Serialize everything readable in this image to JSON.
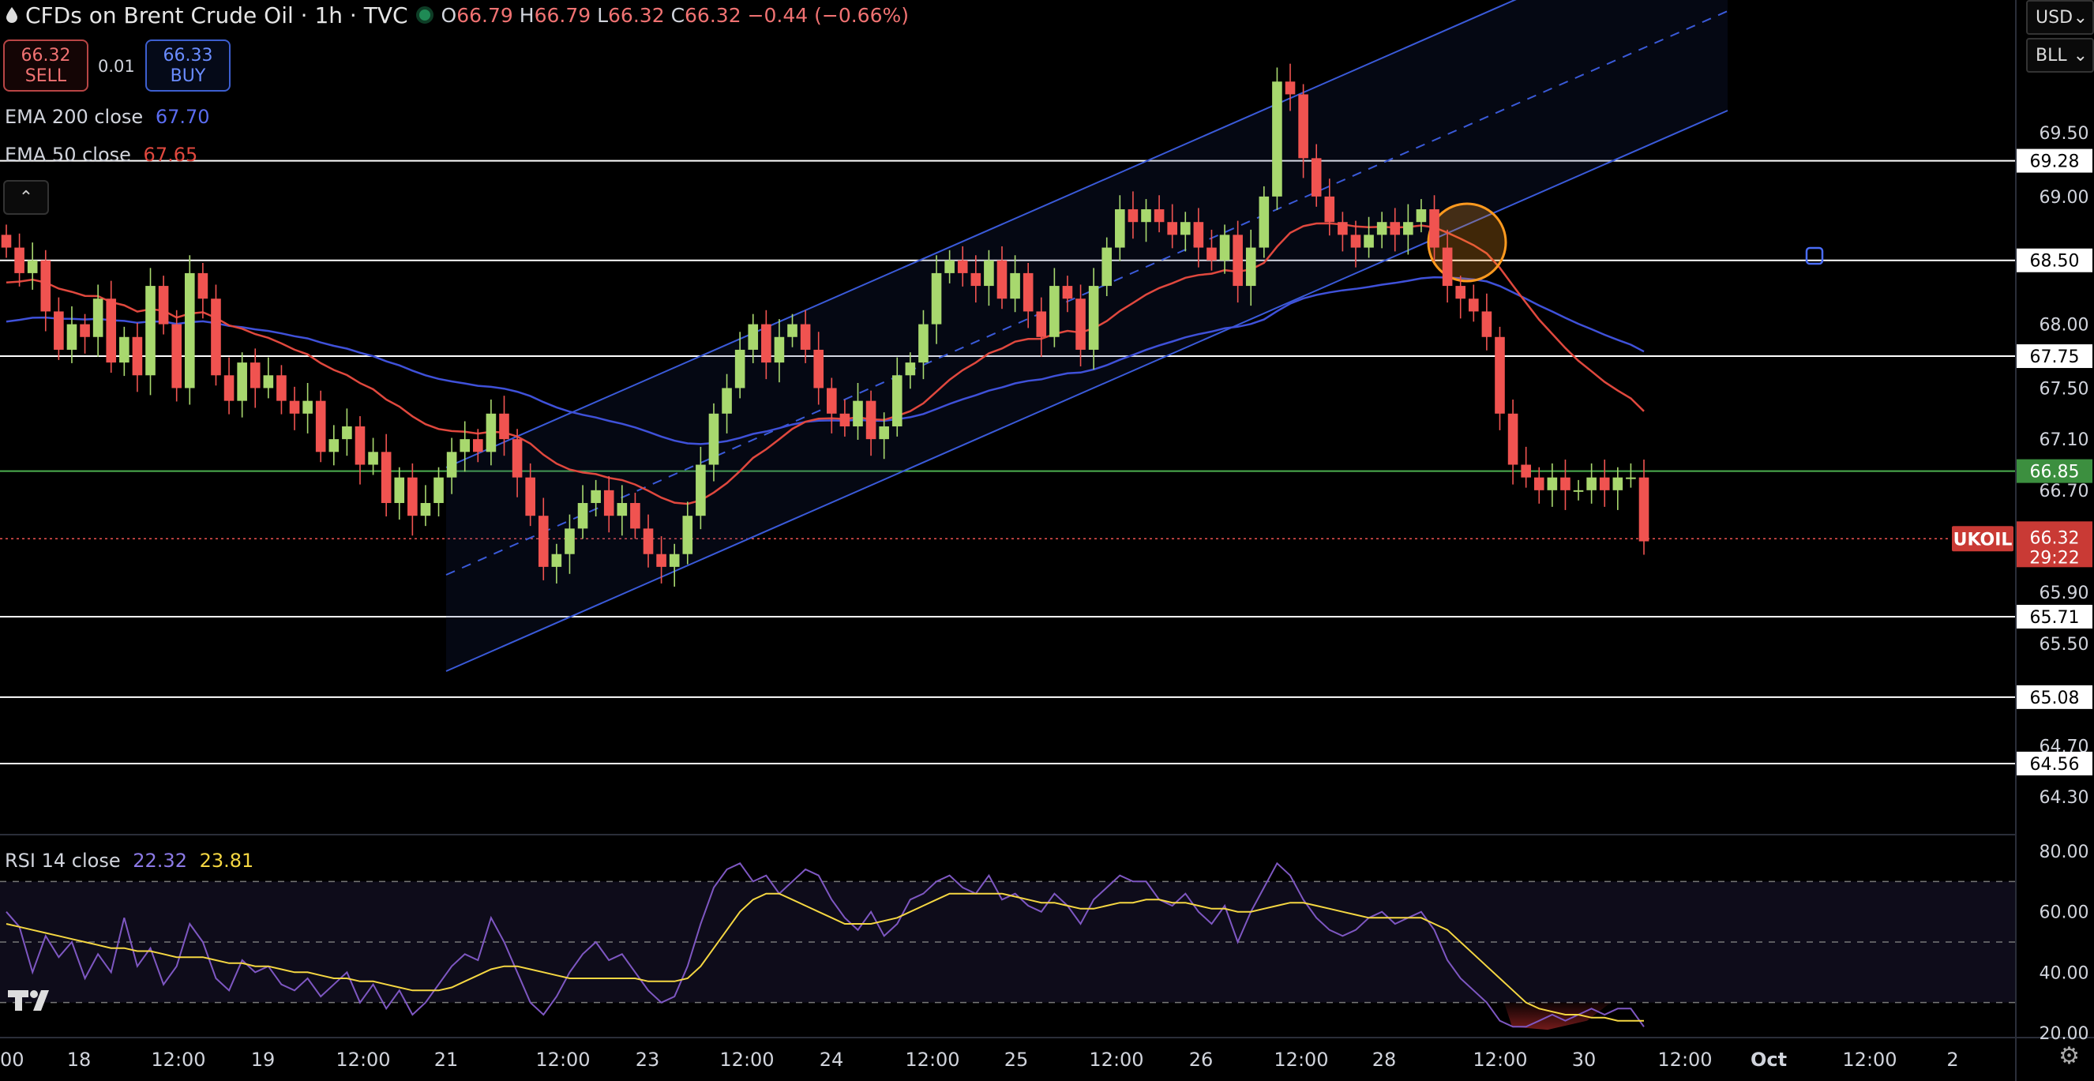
{
  "header": {
    "title": "CFDs on Brent Crude Oil · 1h · TVC",
    "ohlc": {
      "o_lbl": "O",
      "o": "66.79",
      "h_lbl": "H",
      "h": "66.79",
      "l_lbl": "L",
      "l": "66.32",
      "c_lbl": "C",
      "c": "66.32",
      "chg": "−0.44 (−0.66%)"
    }
  },
  "trade": {
    "sell_price": "66.32",
    "sell_label": "SELL",
    "spread": "0.01",
    "buy_price": "66.33",
    "buy_label": "BUY"
  },
  "indicators": {
    "ema200_label": "EMA 200 close",
    "ema200_value": "67.70",
    "ema50_label": "EMA 50 close",
    "ema50_value": "67.65",
    "rsi_label": "RSI 14 close",
    "rsi_value": "22.32",
    "rsi_ma_value": "23.81"
  },
  "top_right": {
    "currency": "USD",
    "unit": "BLL"
  },
  "colors": {
    "up": "#26a69a",
    "green_candle": "#a8d86e",
    "down": "#f05350",
    "ema200": "#3f51d9",
    "ema50": "#e0483e",
    "rsi": "#7e57c2",
    "rsi_ma": "#f5d742",
    "channel": "#3a5ad9",
    "level": "#ffffff",
    "support_green": "#4caf50"
  },
  "chart_data": [
    {
      "type": "candlestick",
      "symbol": "UKOIL",
      "interval": "1h",
      "last_price": "66.32",
      "countdown": "29:22",
      "y_ticks": [
        "69.50",
        "69.00",
        "68.50",
        "68.00",
        "67.50",
        "67.10",
        "66.70",
        "66.30",
        "65.90",
        "65.50",
        "64.70",
        "64.30"
      ],
      "ylim": [
        64.0,
        70.2
      ],
      "x_ticks": [
        "00",
        "18",
        "12:00",
        "19",
        "12:00",
        "21",
        "12:00",
        "23",
        "12:00",
        "24",
        "12:00",
        "25",
        "12:00",
        "26",
        "12:00",
        "28",
        "12:00",
        "30",
        "12:00",
        "Oct",
        "12:00",
        "2"
      ],
      "levels": [
        {
          "value": "69.28",
          "color": "#ffffff"
        },
        {
          "value": "68.50",
          "color": "#ffffff"
        },
        {
          "value": "67.75",
          "color": "#ffffff"
        },
        {
          "value": "66.85",
          "color": "#4caf50"
        },
        {
          "value": "65.71",
          "color": "#ffffff"
        },
        {
          "value": "65.08",
          "color": "#ffffff"
        },
        {
          "value": "64.56",
          "color": "#ffffff"
        }
      ],
      "series": [
        {
          "name": "EMA 200 close",
          "value": 67.7
        },
        {
          "name": "EMA 50 close",
          "value": 67.65
        }
      ],
      "close_path": [
        68.6,
        68.4,
        68.5,
        68.1,
        67.8,
        68.0,
        67.9,
        68.2,
        67.7,
        67.9,
        67.6,
        68.3,
        68.0,
        67.5,
        68.4,
        68.2,
        67.6,
        67.4,
        67.7,
        67.5,
        67.6,
        67.4,
        67.3,
        67.4,
        67.0,
        67.1,
        67.2,
        66.9,
        67.0,
        66.6,
        66.8,
        66.5,
        66.6,
        66.8,
        67.0,
        67.1,
        67.0,
        67.3,
        67.1,
        66.8,
        66.5,
        66.1,
        66.2,
        66.4,
        66.6,
        66.7,
        66.5,
        66.6,
        66.4,
        66.2,
        66.1,
        66.2,
        66.5,
        66.9,
        67.3,
        67.5,
        67.8,
        68.0,
        67.7,
        67.9,
        68.0,
        67.8,
        67.5,
        67.3,
        67.2,
        67.4,
        67.1,
        67.2,
        67.6,
        67.7,
        68.0,
        68.4,
        68.5,
        68.4,
        68.3,
        68.5,
        68.2,
        68.4,
        68.1,
        67.9,
        68.3,
        68.2,
        67.8,
        68.3,
        68.6,
        68.9,
        68.8,
        68.9,
        68.8,
        68.7,
        68.8,
        68.6,
        68.5,
        68.7,
        68.3,
        68.6,
        69.0,
        69.9,
        69.8,
        69.3,
        69.0,
        68.8,
        68.7,
        68.6,
        68.7,
        68.8,
        68.7,
        68.8,
        68.9,
        68.6,
        68.3,
        68.2,
        68.1,
        67.9,
        67.3,
        66.9,
        66.8,
        66.7,
        66.8,
        66.7,
        66.7,
        66.8,
        66.7,
        66.8,
        66.8,
        66.3
      ],
      "rsi": {
        "ylim": [
          15,
          85
        ],
        "y_ticks": [
          "80.00",
          "60.00",
          "40.00",
          "20.00"
        ],
        "values": [
          60,
          55,
          40,
          52,
          45,
          50,
          38,
          46,
          40,
          58,
          42,
          48,
          36,
          42,
          56,
          50,
          38,
          34,
          44,
          40,
          42,
          36,
          34,
          38,
          32,
          36,
          40,
          30,
          36,
          28,
          34,
          26,
          30,
          36,
          42,
          46,
          44,
          58,
          50,
          40,
          30,
          26,
          32,
          40,
          46,
          50,
          44,
          46,
          40,
          34,
          30,
          32,
          42,
          56,
          68,
          74,
          76,
          70,
          72,
          66,
          70,
          74,
          72,
          64,
          58,
          54,
          60,
          52,
          56,
          64,
          66,
          70,
          72,
          68,
          66,
          72,
          64,
          66,
          62,
          60,
          66,
          62,
          56,
          64,
          68,
          72,
          70,
          70,
          64,
          62,
          66,
          60,
          56,
          62,
          50,
          60,
          68,
          76,
          72,
          64,
          58,
          54,
          52,
          54,
          58,
          60,
          56,
          58,
          60,
          54,
          44,
          38,
          34,
          30,
          24,
          22,
          22,
          24,
          26,
          24,
          26,
          28,
          26,
          28,
          28,
          22
        ],
        "ma": [
          56,
          55,
          54,
          53,
          52,
          51,
          50,
          49,
          48,
          48,
          47,
          47,
          46,
          45,
          45,
          45,
          44,
          43,
          43,
          42,
          42,
          41,
          40,
          40,
          39,
          38,
          38,
          37,
          37,
          36,
          35,
          34,
          34,
          34,
          35,
          37,
          39,
          41,
          42,
          42,
          41,
          40,
          39,
          38,
          38,
          38,
          38,
          38,
          38,
          37,
          37,
          37,
          38,
          42,
          48,
          54,
          60,
          64,
          66,
          66,
          64,
          62,
          60,
          58,
          56,
          56,
          56,
          57,
          58,
          60,
          62,
          64,
          66,
          66,
          66,
          66,
          66,
          65,
          64,
          63,
          63,
          62,
          61,
          61,
          62,
          63,
          63,
          64,
          64,
          63,
          63,
          62,
          61,
          61,
          60,
          60,
          61,
          62,
          63,
          63,
          62,
          61,
          60,
          59,
          58,
          58,
          58,
          58,
          58,
          56,
          54,
          50,
          46,
          42,
          38,
          34,
          30,
          28,
          27,
          26,
          26,
          25,
          25,
          24,
          24,
          24
        ]
      }
    }
  ]
}
